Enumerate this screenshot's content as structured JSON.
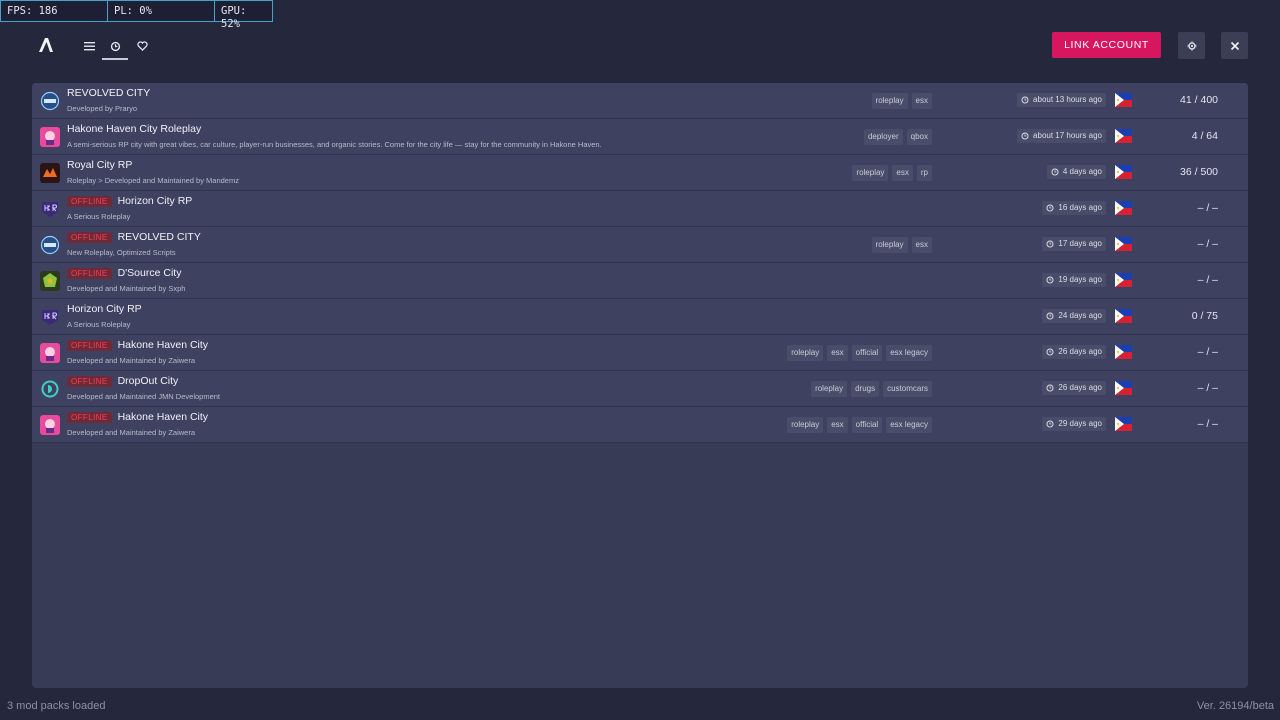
{
  "perf": {
    "fps": "FPS: 186",
    "pl": "PL: 0%",
    "gpu": "GPU: 52%"
  },
  "header": {
    "link_account": "LINK ACCOUNT"
  },
  "servers": [
    {
      "name": "REVOLVED CITY",
      "offline": false,
      "desc": "Developed by Praryo",
      "tags": [
        "roleplay",
        "esx"
      ],
      "time": "about 13 hours ago",
      "players": "41 / 400",
      "icon": "revolved-logo-icon"
    },
    {
      "name": "Hakone Haven City Roleplay",
      "offline": false,
      "desc": "A semi-serious RP city with great vibes, car culture, player-run businesses, and organic stories. Come for the city life — stay for the community in Hakone Haven.",
      "tags": [
        "deployer",
        "qbox"
      ],
      "time": "about 17 hours ago",
      "players": "4 / 64",
      "icon": "hakone-logo-icon"
    },
    {
      "name": "Royal City RP",
      "offline": false,
      "desc": "Roleplay > Developed and Maintained by Mandemz",
      "tags": [
        "roleplay",
        "esx",
        "rp"
      ],
      "time": "4 days ago",
      "players": "36 / 500",
      "icon": "royal-logo-icon"
    },
    {
      "name": "Horizon City RP",
      "offline": true,
      "desc": "A Serious Roleplay",
      "tags": [],
      "time": "16 days ago",
      "players": "– / –",
      "icon": "hcr-logo-icon"
    },
    {
      "name": "REVOLVED CITY",
      "offline": true,
      "desc": "New Roleplay, Optimized Scripts",
      "tags": [
        "roleplay",
        "esx"
      ],
      "time": "17 days ago",
      "players": "– / –",
      "icon": "revolved-logo-icon"
    },
    {
      "name": "D'Source City",
      "offline": true,
      "desc": "Developed and Maintained by Sxph",
      "tags": [],
      "time": "19 days ago",
      "players": "– / –",
      "icon": "dsource-logo-icon"
    },
    {
      "name": "Horizon City RP",
      "offline": false,
      "desc": "A Serious Roleplay",
      "tags": [],
      "time": "24 days ago",
      "players": "0 / 75",
      "icon": "hcr-logo-icon"
    },
    {
      "name": "Hakone Haven City",
      "offline": true,
      "desc": "Developed and Maintained by Zaiwera",
      "tags": [
        "roleplay",
        "esx",
        "official",
        "esx legacy"
      ],
      "time": "26 days ago",
      "players": "– / –",
      "icon": "hakone-logo-icon"
    },
    {
      "name": "DropOut City",
      "offline": true,
      "desc": "Developed and Maintained JMN Development",
      "tags": [
        "roleplay",
        "drugs",
        "customcars"
      ],
      "time": "26 days ago",
      "players": "– / –",
      "icon": "dropout-logo-icon"
    },
    {
      "name": "Hakone Haven City",
      "offline": true,
      "desc": "Developed and Maintained by Zaiwera",
      "tags": [
        "roleplay",
        "esx",
        "official",
        "esx legacy"
      ],
      "time": "29 days ago",
      "players": "– / –",
      "icon": "hakone-logo-icon"
    }
  ],
  "offline_label": "OFFLINE",
  "footer": {
    "left": "3 mod packs loaded",
    "right": "Ver. 26194/beta"
  }
}
